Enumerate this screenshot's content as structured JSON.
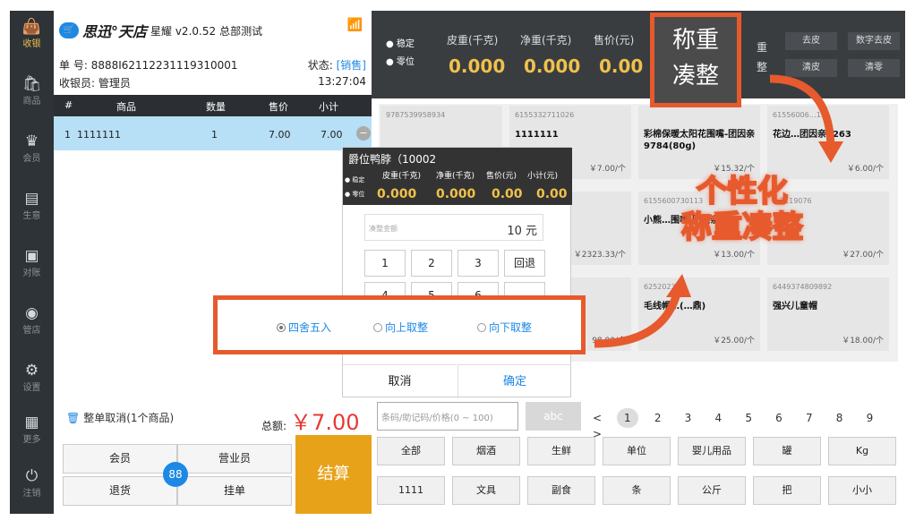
{
  "sidebar": {
    "items": [
      {
        "icon": "cashier-bag-icon",
        "label": "收银",
        "active": true
      },
      {
        "icon": "shopping-bag-icon",
        "label": "商品"
      },
      {
        "icon": "crown-icon",
        "label": "会员"
      },
      {
        "icon": "monitor-icon",
        "label": "生意"
      },
      {
        "icon": "account-icon",
        "label": "对账"
      },
      {
        "icon": "store-icon",
        "label": "管店"
      },
      {
        "icon": "gear-icon",
        "label": "设置"
      },
      {
        "icon": "grid-icon",
        "label": "更多"
      },
      {
        "icon": "power-icon",
        "label": "注销"
      }
    ]
  },
  "header": {
    "brand": "思迅°天店",
    "version": "星耀 v2.0.52",
    "store": "总部测试",
    "order_label": "单 号:",
    "order_no": "8888I62112231119310001",
    "status_label": "状态:",
    "status_value": "[销售]",
    "cashier_label": "收银员:",
    "cashier_name": "管理员",
    "time": "13:27:04"
  },
  "cart": {
    "headers": [
      "#",
      "商品",
      "数量",
      "售价",
      "小计"
    ],
    "rows": [
      {
        "idx": "1",
        "name": "1111111",
        "qty": "1",
        "price": "7.00",
        "subtotal": "7.00"
      }
    ],
    "cancel_all": "整单取消(1个商品)",
    "total_label": "总额:",
    "total_value": "￥7.00"
  },
  "actions": {
    "member": "会员",
    "salesperson": "营业员",
    "return": "退货",
    "hold": "挂单",
    "checkout": "结算",
    "fab": "88"
  },
  "scale": {
    "stable": "稳定",
    "zero": "零位",
    "tare_label": "皮重(千克)",
    "net_label": "净重(千克)",
    "price_label": "售价(元)",
    "tare": "0.000",
    "net": "0.000",
    "price": "0.00",
    "buttons": [
      "去皮",
      "数字去皮",
      "清皮",
      "清零"
    ],
    "partial_a": "重",
    "partial_b": "整"
  },
  "products": [
    {
      "code": "9787539958934",
      "name": "",
      "price": ""
    },
    {
      "code": "6155332711026",
      "name": "1111111",
      "price": "￥7.00/个"
    },
    {
      "code": "",
      "name": "彩棉保暖太阳花围嘴-团因亲9784(80g)",
      "price": "￥15.32/个"
    },
    {
      "code": "61556006…13",
      "name": "花边…团因亲1263",
      "price": "￥6.00/个"
    },
    {
      "code": "",
      "name": "",
      "price": ""
    },
    {
      "code": "",
      "name": "",
      "price": "￥2323.33/个"
    },
    {
      "code": "6155600730113",
      "name": "小熊…围嘴-团因亲…",
      "price": "￥13.00/个"
    },
    {
      "code": "…7119076",
      "name": "",
      "price": "￥27.00/个"
    },
    {
      "code": "",
      "name": "",
      "price": "98.00/个"
    },
    {
      "code": "62520230…",
      "name": "毛线帽…(…鼎)",
      "price": "￥25.00/个"
    },
    {
      "code": "6449374809892",
      "name": "强兴儿童帽",
      "price": "￥18.00/个"
    },
    {
      "code": "",
      "name": "",
      "price": ""
    }
  ],
  "search": {
    "placeholder": "条码/助记码/价格(0 ~ 100)",
    "abc": "abc"
  },
  "pager": {
    "prev": "<",
    "pages": [
      "1",
      "2",
      "3",
      "4",
      "5",
      "6",
      "7",
      "8",
      "9"
    ],
    "next": ">",
    "current": "1"
  },
  "categories_row1": [
    "全部",
    "烟酒",
    "生鲜",
    "单位",
    "婴儿用品",
    "罐",
    "Kg"
  ],
  "categories_row2": [
    "1111",
    "文具",
    "副食",
    "条",
    "公斤",
    "把",
    "小小"
  ],
  "modal": {
    "title": "爵位鸭脖（10002",
    "stable": "稳定",
    "zero": "零位",
    "tare_label": "皮重(千克)",
    "net_label": "净重(千克)",
    "price_label": "售价(元)",
    "subtotal_label": "小计(元)",
    "tare": "0.000",
    "net": "0.000",
    "price": "0.00",
    "subtotal": "0.00",
    "input_placeholder": "凑整金额",
    "input_value": "10 元",
    "keys": [
      "1",
      "2",
      "3",
      "回退",
      "4",
      "5",
      "6",
      ""
    ],
    "cancel": "取消",
    "confirm": "确定"
  },
  "rounding": {
    "options": [
      "四舍五入",
      "向上取整",
      "向下取整"
    ],
    "selected": "四舍五入"
  },
  "callout": {
    "line1": "称重",
    "line2": "凑整"
  },
  "promo": {
    "line1": "个性化",
    "line2": "称重凑整"
  },
  "colors": {
    "accent": "#e65a2d",
    "blue": "#1e88e5",
    "gold": "#f0c14b",
    "dark": "#2e3338",
    "checkout": "#e8a21a"
  }
}
